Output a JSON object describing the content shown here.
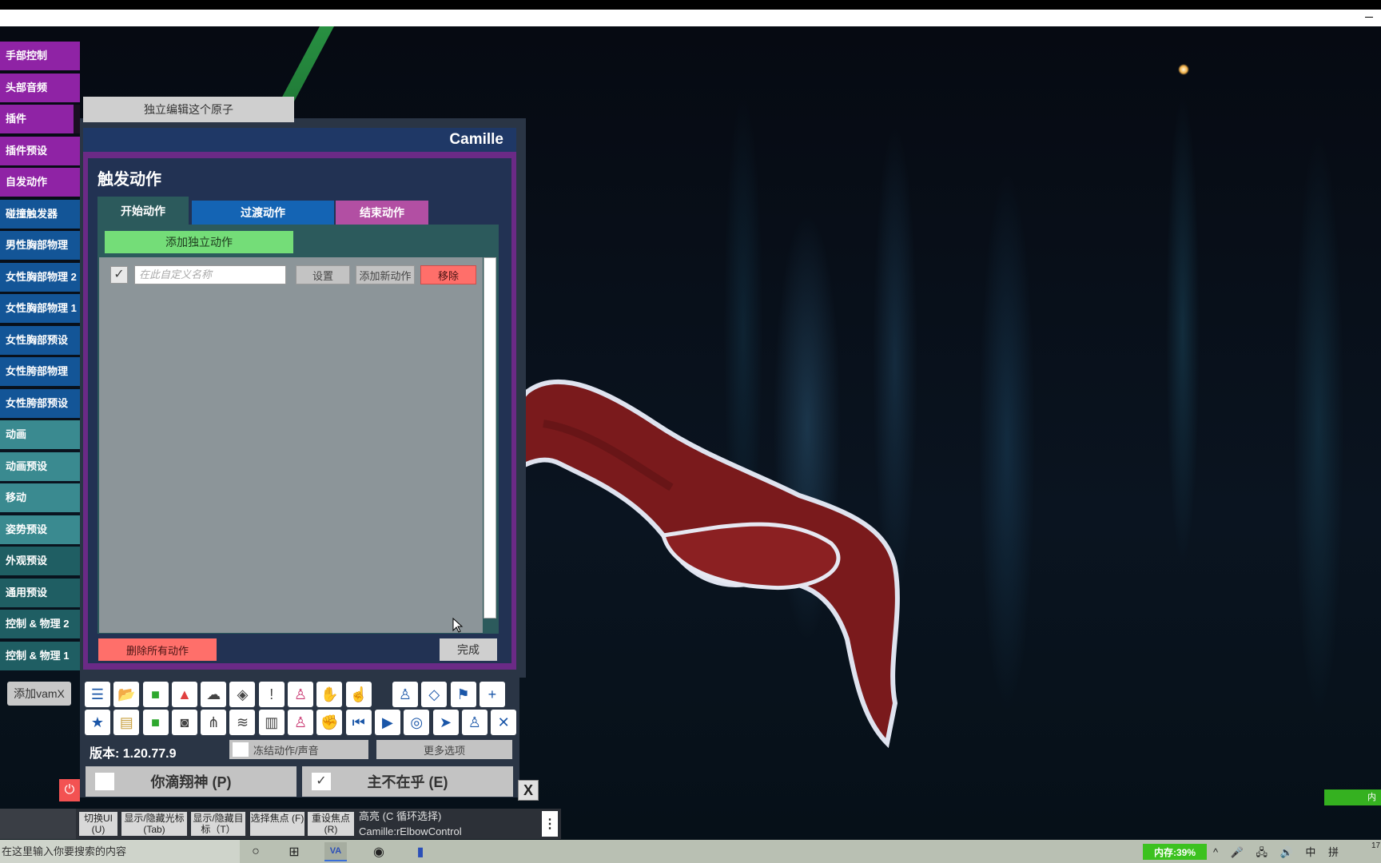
{
  "side_menu": [
    {
      "label": "手部控制",
      "color": "purple"
    },
    {
      "label": "头部音频",
      "color": "purple"
    },
    {
      "label": "插件",
      "color": "purple",
      "active": true
    },
    {
      "label": "插件预设",
      "color": "purple"
    },
    {
      "label": "自发动作",
      "color": "purple"
    },
    {
      "label": "碰撞触发器",
      "color": "blue"
    },
    {
      "label": "男性胸部物理",
      "color": "blue"
    },
    {
      "label": "女性胸部物理 2",
      "color": "blue"
    },
    {
      "label": "女性胸部物理 1",
      "color": "blue"
    },
    {
      "label": "女性胸部预设",
      "color": "blue"
    },
    {
      "label": "女性胯部物理",
      "color": "blue"
    },
    {
      "label": "女性胯部预设",
      "color": "blue"
    },
    {
      "label": "动画",
      "color": "teal"
    },
    {
      "label": "动画预设",
      "color": "teal"
    },
    {
      "label": "移动",
      "color": "teal"
    },
    {
      "label": "姿势预设",
      "color": "teal"
    },
    {
      "label": "外观预设",
      "color": "darkteal"
    },
    {
      "label": "通用预设",
      "color": "darkteal"
    },
    {
      "label": "控制 & 物理 2",
      "color": "darkteal"
    },
    {
      "label": "控制 & 物理 1",
      "color": "darkteal"
    }
  ],
  "add_vamx_label": "添加vamX",
  "edit_atom_label": "独立编辑这个原子",
  "atom_name": "Camille",
  "trigger_panel": {
    "title": "触发动作",
    "tabs": [
      {
        "label": "开始动作",
        "selected": true
      },
      {
        "label": "过渡动作",
        "selected": false
      },
      {
        "label": "结束动作",
        "selected": false
      }
    ],
    "add_independent_label": "添加独立动作",
    "action_row": {
      "checked": true,
      "check_glyph": "✓",
      "name_placeholder": "在此自定义名称",
      "settings_label": "设置",
      "add_new_label": "添加新动作",
      "remove_label": "移除"
    },
    "delete_all_label": "删除所有动作",
    "done_label": "完成"
  },
  "toolbar": {
    "row1_icons": [
      {
        "name": "menu-icon",
        "glyph": "☰",
        "color": "#1a56a8"
      },
      {
        "name": "open-scene-icon",
        "glyph": "📂",
        "color": "#2e9a2e"
      },
      {
        "name": "folder-icon",
        "glyph": "■",
        "color": "#2ea82e"
      },
      {
        "name": "delete-scene-icon",
        "glyph": "▲",
        "color": "#e04040"
      },
      {
        "name": "cloud-download-icon",
        "glyph": "☁",
        "color": "#444"
      },
      {
        "name": "cube-icon",
        "glyph": "◈",
        "color": "#444"
      },
      {
        "name": "warning-icon",
        "glyph": "!",
        "color": "#444"
      },
      {
        "name": "add-person-icon",
        "glyph": "♙",
        "color": "#c8326e"
      },
      {
        "name": "hand-icon",
        "glyph": "✋",
        "color": "#c8326e"
      },
      {
        "name": "pointer-hand-icon",
        "glyph": "☝",
        "color": "#c8326e"
      },
      {
        "name": "person-icon",
        "glyph": "♙",
        "color": "#1a56a8"
      },
      {
        "name": "unity-icon",
        "glyph": "◇",
        "color": "#1a56a8"
      },
      {
        "name": "flag-icon",
        "glyph": "⚑",
        "color": "#1a56a8"
      },
      {
        "name": "plus-icon",
        "glyph": "+",
        "color": "#1a56a8"
      }
    ],
    "row2_icons": [
      {
        "name": "star-icon",
        "glyph": "★",
        "color": "#1a56a8"
      },
      {
        "name": "save-scene-icon",
        "glyph": "▤",
        "color": "#c8a040"
      },
      {
        "name": "settings-folder-icon",
        "glyph": "■",
        "color": "#2ea82e"
      },
      {
        "name": "camera-icon",
        "glyph": "◙",
        "color": "#444"
      },
      {
        "name": "graph-icon",
        "glyph": "⋔",
        "color": "#444"
      },
      {
        "name": "layers-icon",
        "glyph": "≋",
        "color": "#444"
      },
      {
        "name": "document-icon",
        "glyph": "▥",
        "color": "#444"
      },
      {
        "name": "remove-person-icon",
        "glyph": "♙",
        "color": "#c8326e"
      },
      {
        "name": "grab-hand-icon",
        "glyph": "✊",
        "color": "#c8326e"
      },
      {
        "name": "skip-back-icon",
        "glyph": "⏮",
        "color": "#1a56a8"
      },
      {
        "name": "play-icon",
        "glyph": "▶",
        "color": "#1a56a8"
      },
      {
        "name": "target-icon",
        "glyph": "◎",
        "color": "#1a56a8"
      },
      {
        "name": "cursor-icon",
        "glyph": "➤",
        "color": "#1a56a8"
      },
      {
        "name": "people-icon",
        "glyph": "♙",
        "color": "#1a56a8"
      },
      {
        "name": "tools-icon",
        "glyph": "✕",
        "color": "#1a56a8"
      }
    ],
    "version_label": "版本: 1.20.77.9",
    "freeze_label": "冻结动作/声音",
    "more_options_label": "更多选项",
    "toggle1": {
      "label": "你滴翔神 (P)",
      "checked": false
    },
    "toggle2": {
      "label": "主不在乎 (E)",
      "checked": true,
      "check_glyph": "✓"
    },
    "close_label": "X",
    "power_glyph": "⏻"
  },
  "hint_bar": {
    "left_text": "",
    "items": [
      {
        "label": "切换UI (U)"
      },
      {
        "label": "显示/隐藏光标 (Tab)"
      },
      {
        "label": "显示/隐藏目标（T）"
      },
      {
        "label": "选择焦点 (F)"
      },
      {
        "label": "重设焦点 (R)"
      }
    ],
    "highlight_line": "高亮 (C 循环选择)",
    "selected_line": "Camille:rElbowControl",
    "menu_glyph": "⋮"
  },
  "side_memory_tag": "内存",
  "taskbar": {
    "search_placeholder": "在这里输入你要搜索的内容",
    "apps": [
      {
        "name": "cortana-icon",
        "glyph": "○"
      },
      {
        "name": "task-view-icon",
        "glyph": "⊞"
      },
      {
        "name": "vam-app-icon",
        "glyph": "VA",
        "active": true
      },
      {
        "name": "obs-icon",
        "glyph": "◉"
      },
      {
        "name": "app-icon",
        "glyph": "▮"
      }
    ],
    "memory_label": "内存:39%",
    "tray_text": "^ 🎤 🖧 🔊 中 拼",
    "clock": "17"
  }
}
